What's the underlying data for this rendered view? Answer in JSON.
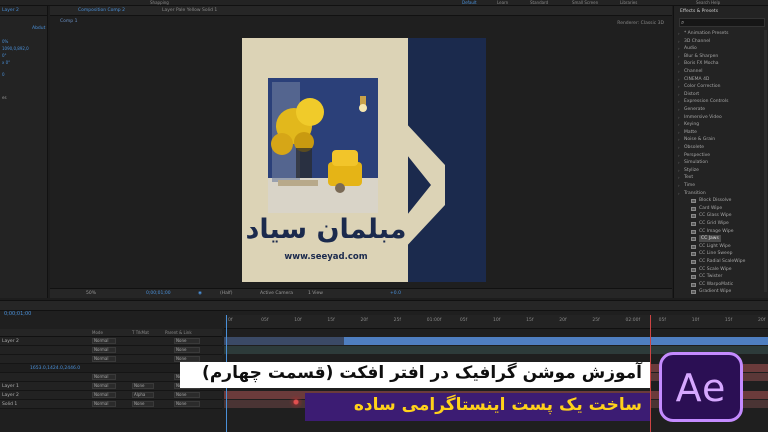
{
  "app": {
    "menubar": [
      "Shapping",
      "Default",
      "Learn",
      "Standard",
      "Small Screen",
      "Libraries",
      "Search Help"
    ]
  },
  "left_panel": {
    "tab": "Layer 2",
    "tab2": "Abdut",
    "lines": [
      "0%",
      "1090,0,892,0",
      "0°",
      "x 0°",
      "0",
      "es"
    ]
  },
  "composition": {
    "tabs": [
      "Composition Comp 2",
      "Layer Pale Yellow Solid 1"
    ],
    "subtab": "Comp 1",
    "renderer": "Renderer:  Classic 3D",
    "canvas": {
      "brand_text": "مبلمان سیاد",
      "url": "www.seeyad.com",
      "colors": {
        "navy": "#1b2a4d",
        "beige": "#dcd3b6"
      }
    },
    "viewer_bar": {
      "zoom": "50%",
      "timecode": "0;00;01;00",
      "resolution": "(Half)",
      "camera": "Active Camera",
      "views": "1 View",
      "exposure": "+0.0"
    }
  },
  "effects": {
    "title": "Effects & Presets",
    "search_placeholder": "",
    "categories": [
      "* Animation Presets",
      "3D Channel",
      "Audio",
      "Blur & Sharpen",
      "Boris FX Mocha",
      "Channel",
      "CINEMA 4D",
      "Color Correction",
      "Distort",
      "Expression Controls",
      "Generate",
      "Immersive Video",
      "Keying",
      "Matte",
      "Noise & Grain",
      "Obsolete",
      "Perspective",
      "Simulation",
      "Stylize",
      "Text",
      "Time",
      "Transition"
    ],
    "transition_items": [
      "Block Dissolve",
      "Card Wipe",
      "CC Glass Wipe",
      "CC Grid Wipe",
      "CC Image Wipe",
      "CC Jaws",
      "CC Light Wipe",
      "CC Line Sweep",
      "CC Radial ScaleWipe",
      "CC Scale Wipe",
      "CC Twister",
      "CC WarpoMatic",
      "Gradient Wipe"
    ],
    "selected": "CC Jaws"
  },
  "timeline": {
    "timecode": "0;00;01;00",
    "columns": [
      "Mode",
      "T TrkMat",
      "Parent & Link"
    ],
    "layers": [
      {
        "name": "Layer 2",
        "mode": "Normal",
        "trkmat": "",
        "parent": "None"
      },
      {
        "name": "",
        "mode": "Normal",
        "trkmat": "",
        "parent": "None"
      },
      {
        "name": "",
        "mode": "Normal",
        "trkmat": "",
        "parent": "None"
      },
      {
        "name": "",
        "mode": "Normal",
        "trkmat": "",
        "parent": "None"
      },
      {
        "name": "Layer 1",
        "mode": "Normal",
        "trkmat": "None",
        "parent": "None"
      },
      {
        "name": "Layer 2",
        "mode": "Normal",
        "trkmat": "Alpha",
        "parent": "None"
      },
      {
        "name": "Solid 1",
        "mode": "Normal",
        "trkmat": "None",
        "parent": "None"
      }
    ],
    "prop_value": "1653.0,1424.0,2446.0",
    "ruler": [
      "0f",
      "05f",
      "10f",
      "15f",
      "20f",
      "25f",
      "01:00f",
      "05f",
      "10f",
      "15f",
      "20f",
      "25f",
      "02:00f",
      "05f",
      "10f",
      "15f",
      "20f"
    ]
  },
  "overlay": {
    "title_line": "آموزش موشن گرافیک در افتر افکت  (قسمت چهارم)",
    "subtitle_line": "ساخت یک پست اینستاگرامی ساده",
    "logo_text": "Ae",
    "colors": {
      "banner_white": "#ffffff",
      "banner_purple": "#3c1c73",
      "subtitle_yellow": "#ffd21a",
      "logo_purple": "#c48bff"
    }
  }
}
